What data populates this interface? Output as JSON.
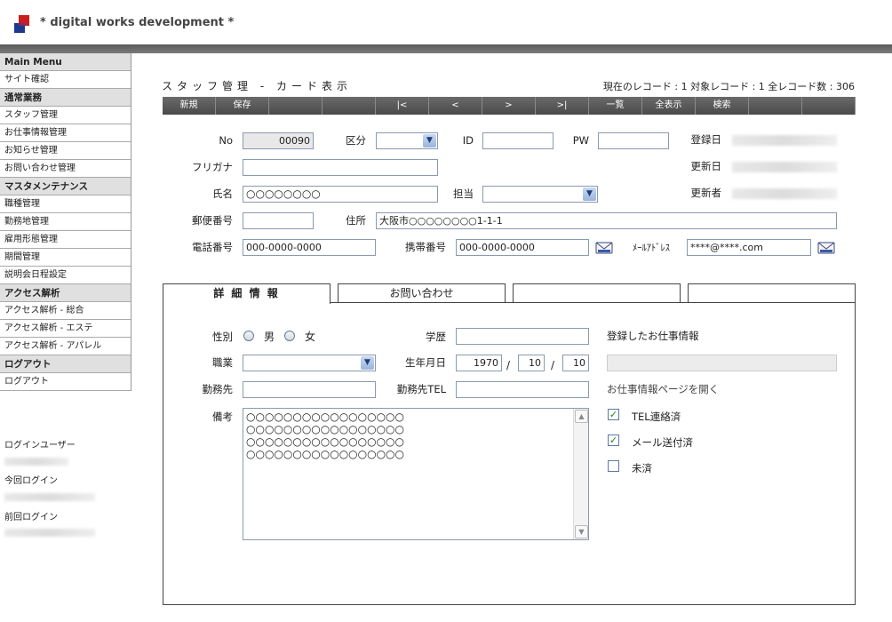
{
  "header": {
    "brand": "* digital works development *"
  },
  "sidebar": {
    "items": [
      {
        "label": "Main Menu",
        "type": "head"
      },
      {
        "label": "サイト確認",
        "type": "item"
      },
      {
        "label": "通常業務",
        "type": "head"
      },
      {
        "label": "スタッフ管理",
        "type": "item"
      },
      {
        "label": "お仕事情報管理",
        "type": "item"
      },
      {
        "label": "お知らせ管理",
        "type": "item"
      },
      {
        "label": "お問い合わせ管理",
        "type": "item"
      },
      {
        "label": "マスタメンテナンス",
        "type": "head"
      },
      {
        "label": "職種管理",
        "type": "item"
      },
      {
        "label": "勤務地管理",
        "type": "item"
      },
      {
        "label": "雇用形態管理",
        "type": "item"
      },
      {
        "label": "期間管理",
        "type": "item"
      },
      {
        "label": "説明会日程設定",
        "type": "item"
      },
      {
        "label": "アクセス解析",
        "type": "head"
      },
      {
        "label": "アクセス解析 - 総合",
        "type": "item"
      },
      {
        "label": "アクセス解析 - エステ",
        "type": "item"
      },
      {
        "label": "アクセス解析 - アパレル",
        "type": "item"
      },
      {
        "label": "ログアウト",
        "type": "head"
      },
      {
        "label": "ログアウト",
        "type": "item"
      }
    ],
    "login_user_label": "ログインユーザー",
    "current_login_label": "今回ログイン",
    "previous_login_label": "前回ログイン"
  },
  "page": {
    "title": "スタッフ管理 - カード表示",
    "records": "現在のレコード : 1  対象レコード : 1  全レコード数 : 306"
  },
  "toolbar": [
    "新規",
    "保存",
    "",
    "",
    "|<",
    "<",
    ">",
    ">|",
    "一覧",
    "全表示",
    "検索",
    "",
    ""
  ],
  "form": {
    "no_label": "No",
    "no_value": "00090",
    "kubun_label": "区分",
    "id_label": "ID",
    "id_value": "",
    "pw_label": "PW",
    "pw_value": "",
    "registered_label": "登録日",
    "furigana_label": "フリガナ",
    "furigana_value": "",
    "updated_label": "更新日",
    "name_label": "氏名",
    "name_value": "○○○○○○○○",
    "tanto_label": "担当",
    "updater_label": "更新者",
    "zip_label": "郵便番号",
    "zip_value": "",
    "address_label": "住所",
    "address_value": "大阪市○○○○○○○○1-1-1",
    "phone_label": "電話番号",
    "phone_value": "000-0000-0000",
    "mobile_label": "携帯番号",
    "mobile_value": "000-0000-0000",
    "email_label": "ﾒｰﾙｱﾄﾞﾚｽ",
    "email_value": "****@****.com"
  },
  "tabs": [
    "詳 細 情 報",
    "お問い合わせ",
    "",
    ""
  ],
  "detail": {
    "gender_label": "性別",
    "male_label": "男",
    "female_label": "女",
    "education_label": "学歴",
    "education_value": "",
    "registered_jobs_label": "登録したお仕事情報",
    "occupation_label": "職業",
    "birth_label": "生年月日",
    "birth_year": "1970",
    "birth_month": "10",
    "birth_day": "10",
    "date_sep": "/",
    "workplace_label": "勤務先",
    "workplace_value": "",
    "workplace_tel_label": "勤務先TEL",
    "workplace_tel_value": "",
    "open_jobs_label": "お仕事情報ページを開く",
    "memo_label": "備考",
    "memo_value": "○○○○○○○○○○○○○○○○○\n○○○○○○○○○○○○○○○○○\n○○○○○○○○○○○○○○○○○\n○○○○○○○○○○○○○○○○○",
    "checks": [
      {
        "label": "TEL連絡済",
        "checked": true
      },
      {
        "label": "メール送付済",
        "checked": true
      },
      {
        "label": "未済",
        "checked": false
      }
    ]
  }
}
